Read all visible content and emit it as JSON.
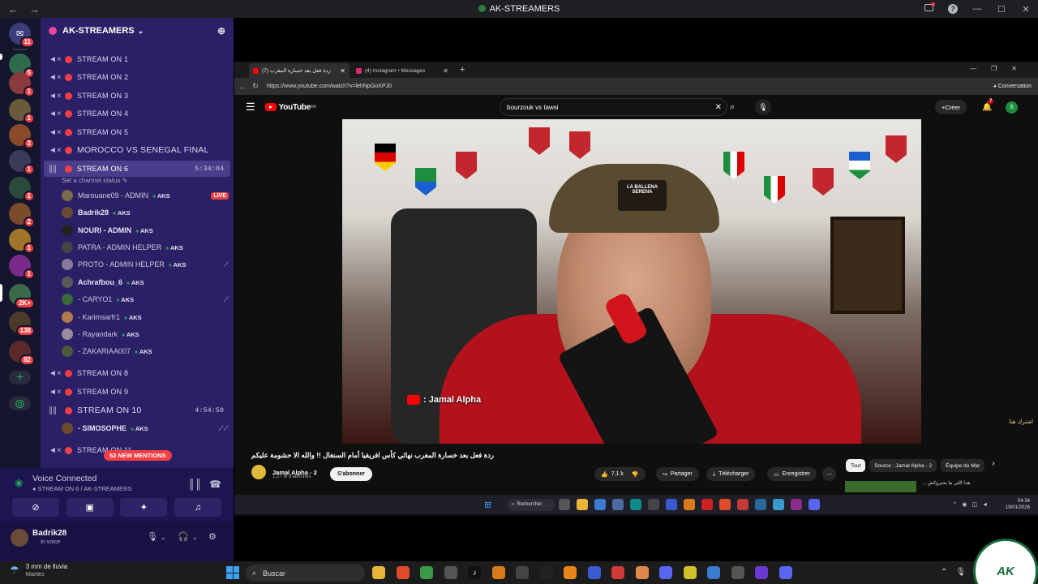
{
  "window": {
    "title": "AK-STREAMERS"
  },
  "server": {
    "name": "AK-STREAMERS"
  },
  "rail_badges": [
    "11",
    "5",
    "1",
    "1",
    "2",
    "1",
    "1",
    "2",
    "1",
    "1",
    "2K+",
    "138",
    "82"
  ],
  "channels_top": [
    {
      "name": "STREAM ON 1"
    },
    {
      "name": "STREAM ON 2"
    },
    {
      "name": "STREAM ON 3"
    },
    {
      "name": "STREAM ON 4"
    },
    {
      "name": "STREAM ON 5"
    },
    {
      "name": "MOROCCO VS SENEGAL FINAL"
    }
  ],
  "channel_active": {
    "name": "STREAM ON 6",
    "time": "5:34:04",
    "status": "Set a channel status"
  },
  "members": [
    {
      "name": "Marouane09 - ADMIN",
      "tag": "AKS",
      "live": "LIVE"
    },
    {
      "name": "Badrik28",
      "tag": "AKS"
    },
    {
      "name": "NOURI - ADMIN",
      "tag": "AKS"
    },
    {
      "name": "PATRA - ADMIN HELPER",
      "tag": "AKS"
    },
    {
      "name": "PROTO - ADMIN HELPER",
      "tag": "AKS"
    },
    {
      "name": "Achrafbou_6",
      "tag": "AKS"
    },
    {
      "name": "- CARYO1",
      "tag": "AKS"
    },
    {
      "name": "- Karimsarfr1",
      "tag": "AKS"
    },
    {
      "name": "- Rayandark",
      "tag": "AKS"
    },
    {
      "name": "- ZAKARIAA007",
      "tag": "AKS"
    }
  ],
  "channels_bottom": [
    {
      "name": "STREAM ON 8"
    },
    {
      "name": "STREAM ON 9"
    },
    {
      "name": "STREAM ON 10",
      "time": "4:54:50"
    }
  ],
  "member_ch10": {
    "name": "- SIMOSOPHE",
    "tag": "AKS"
  },
  "channels_tail": [
    {
      "name": "STREAM ON 11"
    }
  ],
  "mentions": "52 NEW MENTIONS",
  "voice": {
    "status": "Voice Connected",
    "channel": "STREAM ON 6 / AK-STREAMERS"
  },
  "user": {
    "name": "Badrik28",
    "status": "In voice"
  },
  "browser": {
    "tabs": [
      {
        "label": "(7) ردة فعل بعد خسارة المغرب"
      },
      {
        "label": "(4) Instagram • Messages"
      }
    ],
    "url": "https://www.youtube.com/watch?v=lehNpGoXPJ0",
    "conversation": "Conversation"
  },
  "youtube": {
    "logo": "YouTube",
    "region": "MA",
    "search": "bourzouk vs tawsi",
    "create": "Créer",
    "notif": "7",
    "avatar": "S",
    "watermark": ": Jamal Alpha",
    "video_title": "ردة فعل بعد خسارة المغرب نهائي كأس افريقيا أمام السنغال !! والله الا حشومة عليكم",
    "channel": "Jamal Alpha - 2",
    "subs": "1,27 M d'abonnés",
    "subscribe": "S'abonner",
    "likes": "7,1 k",
    "share": "Partager",
    "download": "Télécharger",
    "save": "Enregistrer",
    "chips": [
      "Tout",
      "Source : Jamal Alpha - 2",
      "Équipe du Mar"
    ],
    "side_overlay": "اشترك هنا",
    "rec_title": "هذا اللي ما يخبروكش ..."
  },
  "inner_taskbar": {
    "search": "Rechercher",
    "time": "04:34",
    "date": "19/01/2026"
  },
  "weather": {
    "line1": "3 mm de lluvia",
    "line2": "Martes"
  },
  "outer_taskbar": {
    "search": "Buscar"
  },
  "logo": "AK",
  "colors": {
    "live": "#ed4245",
    "sidebar": "#2b1f66",
    "accent": "#23a559"
  }
}
